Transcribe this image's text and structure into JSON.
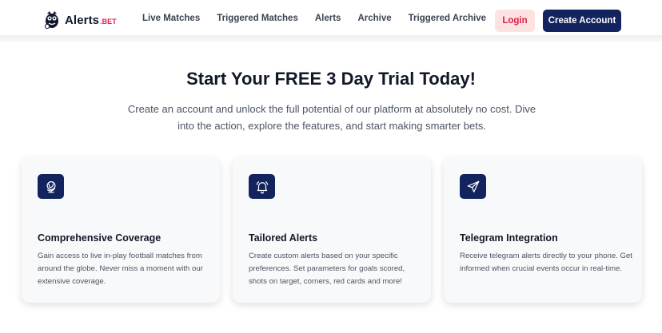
{
  "brand": {
    "name": "Alerts",
    "suffix": ".BET"
  },
  "nav": {
    "links": [
      "Live Matches",
      "Triggered Matches",
      "Alerts",
      "Archive",
      "Triggered Archive"
    ],
    "login_label": "Login",
    "create_label": "Create Account"
  },
  "hero": {
    "title": "Start Your FREE 3 Day Trial Today!",
    "subtitle": "Create an account and unlock the full potential of our platform at absolutely no cost. Dive into the action, explore the features, and start making smarter bets."
  },
  "features": [
    {
      "icon": "globe-icon",
      "title": "Comprehensive Coverage",
      "description": "Gain access to live in-play football matches from around the globe. Never miss a moment with our extensive coverage."
    },
    {
      "icon": "bell-icon",
      "title": "Tailored Alerts",
      "description": "Create custom alerts based on your specific preferences. Set parameters for goals scored, shots on target, corners, red cards and more!"
    },
    {
      "icon": "paper-plane-icon",
      "title": "Telegram Integration",
      "description": "Receive telegram alerts directly to your phone. Get informed when crucial events occur in real-time."
    }
  ],
  "colors": {
    "brand_navy": "#13235e",
    "accent_red": "#e11d48",
    "login_bg": "#fde2e2"
  }
}
